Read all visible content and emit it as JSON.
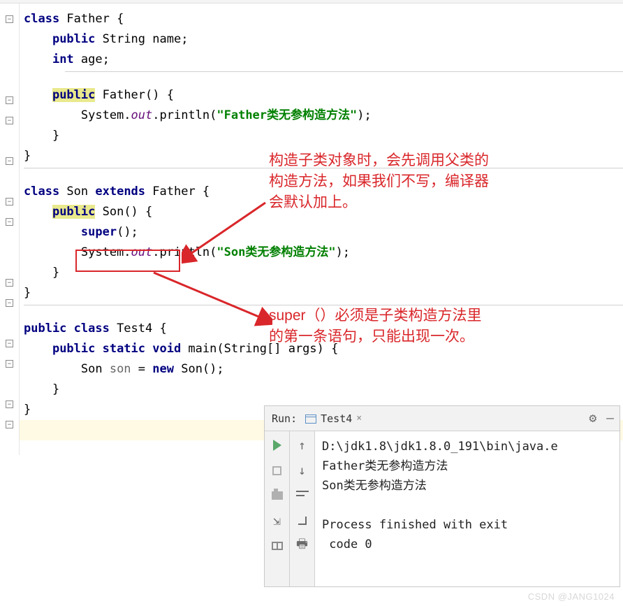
{
  "code": {
    "line1_kw1": "class",
    "line1_cls": " Father {",
    "line2_kw": "public",
    "line2_type": " String ",
    "line2_name": "name;",
    "line3_kw": "int",
    "line3_name": " age;",
    "line5_kw": "public",
    "line5_method": " Father() {",
    "line6_pre": "        System.",
    "line6_out": "out",
    "line6_mid": ".println(",
    "line6_str": "\"Father类无参构造方法\"",
    "line6_end": ");",
    "line7": "    }",
    "line8": "}",
    "line10_kw1": "class",
    "line10_cls1": " Son ",
    "line10_kw2": "extends",
    "line10_cls2": " Father {",
    "line11_kw": "public",
    "line11_method": " Son() {",
    "line12_kw": "super",
    "line12_end": "();",
    "line13_pre": "        System.",
    "line13_out": "out",
    "line13_mid": ".println(",
    "line13_str": "\"Son类无参构造方法\"",
    "line13_end": ");",
    "line14": "    }",
    "line15": "}",
    "line17_kw1": "public class",
    "line17_cls": " Test4 {",
    "line18_kw": "public static void",
    "line18_method": " main(String[] args) {",
    "line19_pre": "        Son ",
    "line19_var": "son",
    "line19_eq": " = ",
    "line19_kw": "new",
    "line19_end": " Son();",
    "line20": "    }",
    "line21": "}"
  },
  "annotation1": "构造子类对象时，会先调用父类的\n构造方法，如果我们不写，编译器\n会默认加上。",
  "annotation2": "super（）必须是子类构造方法里\n的第一条语句，只能出现一次。",
  "run": {
    "label": "Run:",
    "tab": "Test4",
    "close": "×",
    "output": "D:\\jdk1.8\\jdk1.8.0_191\\bin\\java.e\nFather类无参构造方法\nSon类无参构造方法\n\nProcess finished with exit\n code 0"
  },
  "watermark": "CSDN @JANG1024"
}
